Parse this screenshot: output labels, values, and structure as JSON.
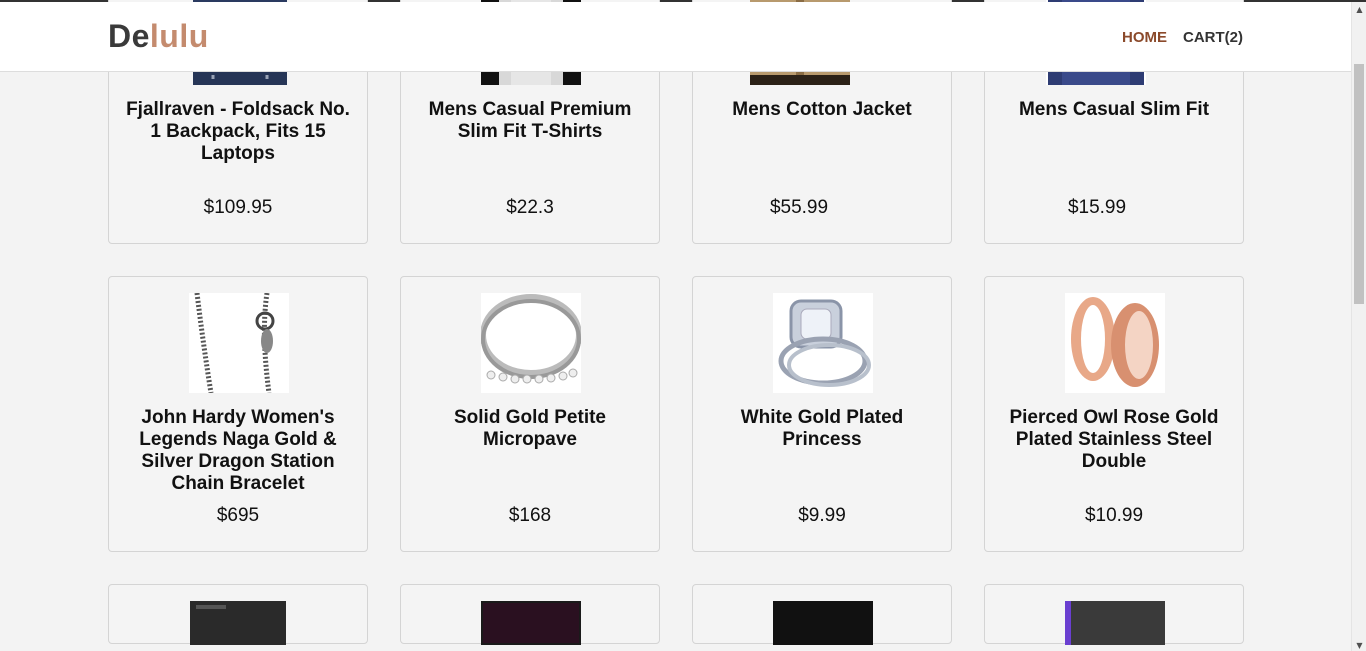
{
  "header": {
    "logo_part1": "De",
    "logo_part2": "lulu",
    "nav_home": "HOME",
    "nav_cart": "CART(2)"
  },
  "colors": {
    "accent": "#c48b6e",
    "nav_active": "#8b4a2b",
    "background": "#f3f3f3"
  },
  "products": [
    {
      "title": "Fjallraven - Foldsack No. 1 Backpack, Fits 15 Laptops",
      "price": "$109.95",
      "image": "backpack"
    },
    {
      "title": "Mens Casual Premium Slim Fit T-Shirts",
      "price": "$22.3",
      "image": "tshirt"
    },
    {
      "title": "Mens Cotton Jacket",
      "price": "$55.99",
      "image": "jacket"
    },
    {
      "title": "Mens Casual Slim Fit",
      "price": "$15.99",
      "image": "longsleeve"
    },
    {
      "title": "John Hardy Women's Legends Naga Gold & Silver Dragon Station Chain Bracelet",
      "price": "$695",
      "image": "bracelet"
    },
    {
      "title": "Solid Gold Petite Micropave",
      "price": "$168",
      "image": "ring-band"
    },
    {
      "title": "White Gold Plated Princess",
      "price": "$9.99",
      "image": "diamond-ring"
    },
    {
      "title": "Pierced Owl Rose Gold Plated Stainless Steel Double",
      "price": "$10.99",
      "image": "rose-gold-plugs"
    }
  ],
  "icons": {
    "scroll_up": "scroll-up-arrow-icon",
    "scroll_down": "scroll-down-arrow-icon"
  }
}
